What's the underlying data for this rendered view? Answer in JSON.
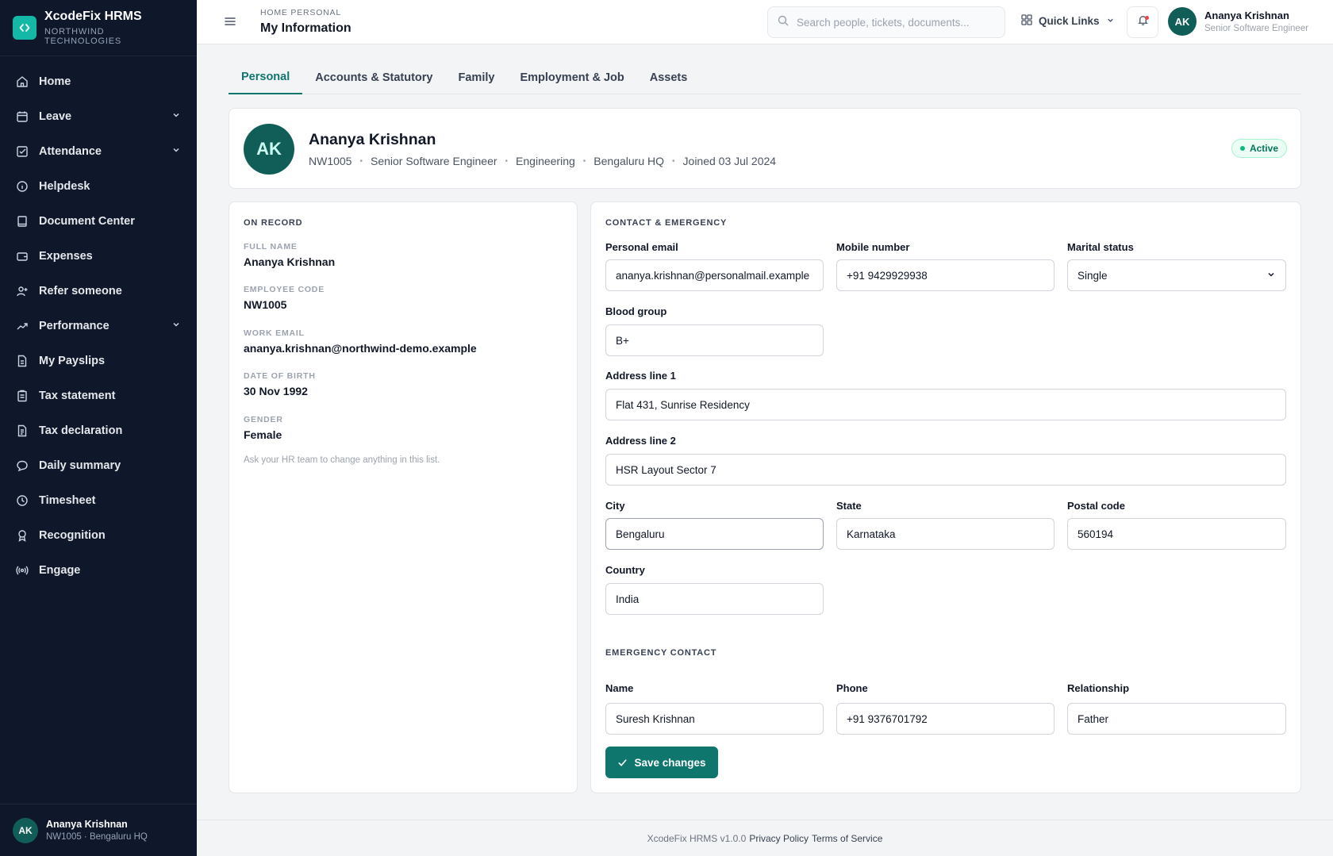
{
  "brand": {
    "name": "XcodeFix HRMS",
    "org": "NORTHWIND TECHNOLOGIES",
    "accent": "#14b8a6"
  },
  "sidebar": {
    "items": [
      {
        "label": "Home",
        "icon": "home-icon",
        "expandable": false
      },
      {
        "label": "Leave",
        "icon": "calendar-icon",
        "expandable": true
      },
      {
        "label": "Attendance",
        "icon": "checkbox-icon",
        "expandable": true
      },
      {
        "label": "Helpdesk",
        "icon": "info-icon",
        "expandable": false
      },
      {
        "label": "Document Center",
        "icon": "book-icon",
        "expandable": false
      },
      {
        "label": "Expenses",
        "icon": "wallet-icon",
        "expandable": false
      },
      {
        "label": "Refer someone",
        "icon": "user-plus-icon",
        "expandable": false
      },
      {
        "label": "Performance",
        "icon": "trending-up-icon",
        "expandable": true
      },
      {
        "label": "My Payslips",
        "icon": "file-icon",
        "expandable": false
      },
      {
        "label": "Tax statement",
        "icon": "clipboard-icon",
        "expandable": false
      },
      {
        "label": "Tax declaration",
        "icon": "file-text-icon",
        "expandable": false
      },
      {
        "label": "Daily summary",
        "icon": "chat-bubble-icon",
        "expandable": false
      },
      {
        "label": "Timesheet",
        "icon": "clock-icon",
        "expandable": false
      },
      {
        "label": "Recognition",
        "icon": "award-icon",
        "expandable": false
      },
      {
        "label": "Engage",
        "icon": "broadcast-icon",
        "expandable": false
      }
    ],
    "user": {
      "initials": "AK",
      "name": "Ananya Krishnan",
      "sub": "NW1005 · Bengaluru HQ"
    }
  },
  "topbar": {
    "breadcrumb": "HOME PERSONAL",
    "title": "My Information",
    "search_placeholder": "Search people, tickets, documents...",
    "quick_links": "Quick Links",
    "user": {
      "initials": "AK",
      "name": "Ananya Krishnan",
      "role": "Senior Software Engineer"
    }
  },
  "tabs": [
    "Personal",
    "Accounts & Statutory",
    "Family",
    "Employment & Job",
    "Assets"
  ],
  "active_tab": "Personal",
  "profile": {
    "initials": "AK",
    "name": "Ananya Krishnan",
    "code": "NW1005",
    "role": "Senior Software Engineer",
    "department": "Engineering",
    "location": "Bengaluru HQ",
    "joined": "Joined 03 Jul 2024",
    "status": "Active"
  },
  "record": {
    "title": "ON RECORD",
    "fields": [
      {
        "label": "FULL NAME",
        "value": "Ananya Krishnan"
      },
      {
        "label": "EMPLOYEE CODE",
        "value": "NW1005"
      },
      {
        "label": "WORK EMAIL",
        "value": "ananya.krishnan@northwind-demo.example"
      },
      {
        "label": "DATE OF BIRTH",
        "value": "30 Nov 1992"
      },
      {
        "label": "GENDER",
        "value": "Female"
      }
    ],
    "note": "Ask your HR team to change anything in this list."
  },
  "contact": {
    "title": "CONTACT & EMERGENCY",
    "personal_email": {
      "label": "Personal email",
      "value": "ananya.krishnan@personalmail.example"
    },
    "mobile": {
      "label": "Mobile number",
      "value": "+91 9429929938"
    },
    "marital": {
      "label": "Marital status",
      "value": "Single"
    },
    "blood": {
      "label": "Blood group",
      "value": "B+"
    },
    "address1": {
      "label": "Address line 1",
      "value": "Flat 431, Sunrise Residency"
    },
    "address2": {
      "label": "Address line 2",
      "value": "HSR Layout Sector 7"
    },
    "city": {
      "label": "City",
      "value": "Bengaluru"
    },
    "state": {
      "label": "State",
      "value": "Karnataka"
    },
    "postal": {
      "label": "Postal code",
      "value": "560194"
    },
    "country": {
      "label": "Country",
      "value": "India"
    }
  },
  "emergency": {
    "title": "EMERGENCY CONTACT",
    "name": {
      "label": "Name",
      "value": "Suresh Krishnan"
    },
    "phone": {
      "label": "Phone",
      "value": "+91 9376701792"
    },
    "relationship": {
      "label": "Relationship",
      "value": "Father"
    }
  },
  "save_label": "Save changes",
  "footer": {
    "version": "XcodeFix HRMS v1.0.0",
    "privacy": "Privacy Policy",
    "terms": "Terms of Service"
  }
}
